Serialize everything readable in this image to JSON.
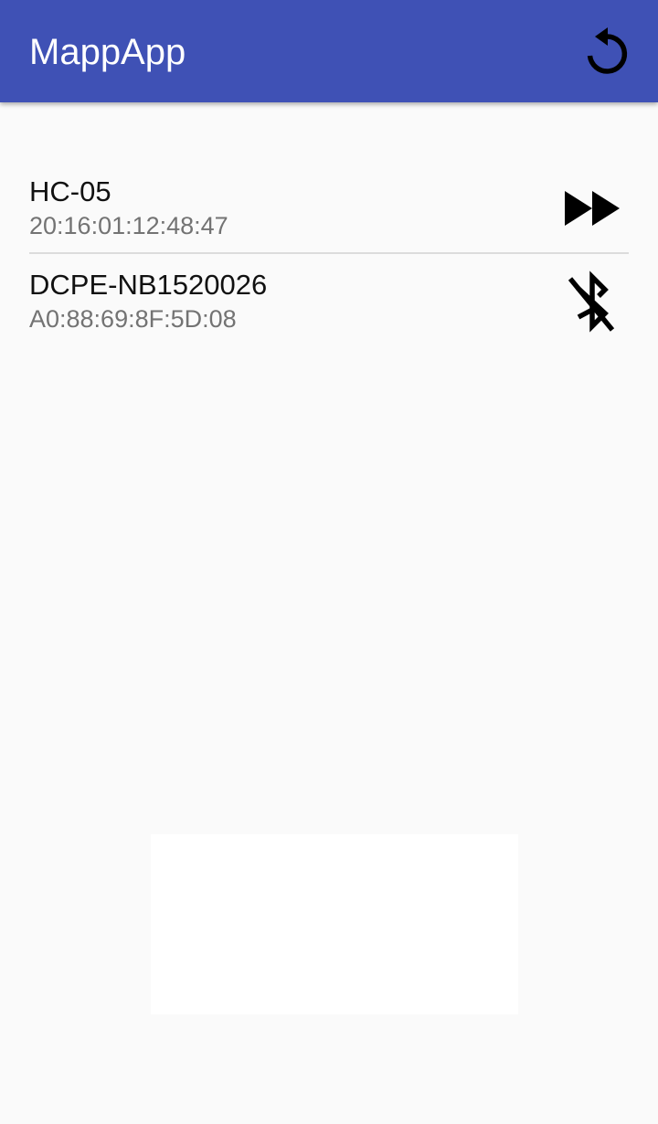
{
  "app_bar": {
    "title": "MappApp",
    "refresh_icon": "refresh-icon",
    "background_color": "#3f51b5"
  },
  "devices": [
    {
      "name": "HC-05",
      "address": "20:16:01:12:48:47",
      "action_icon": "fast-forward-icon"
    },
    {
      "name": "DCPE-NB1520026",
      "address": "A0:88:69:8F:5D:08",
      "action_icon": "bluetooth-disabled-icon"
    }
  ]
}
